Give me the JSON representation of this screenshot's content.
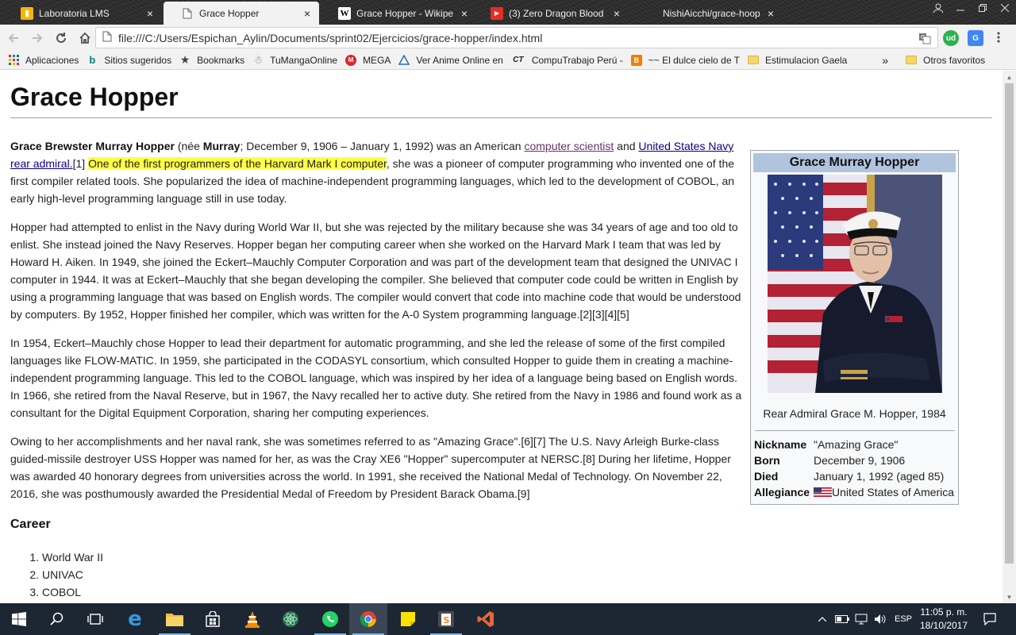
{
  "browser": {
    "tabs": [
      {
        "title": "Laboratoria LMS",
        "icon": "laboratoria-icon",
        "active": false
      },
      {
        "title": "Grace Hopper",
        "icon": "page-icon",
        "active": true
      },
      {
        "title": "Grace Hopper - Wikipe",
        "icon": "wikipedia-icon",
        "active": false
      },
      {
        "title": "(3) Zero Dragon Blood",
        "icon": "youtube-icon",
        "active": false
      },
      {
        "title": "NishiAicchi/grace-hoop",
        "icon": "github-icon",
        "active": false
      }
    ],
    "close_glyph": "×",
    "url": "file:///C:/Users/Espichan_Aylin/Documents/sprint02/Ejercicios/grace-hopper/index.html",
    "bookmarks": [
      {
        "label": "Aplicaciones",
        "icon": "apps-grid-icon"
      },
      {
        "label": "Sitios sugeridos",
        "icon": "bing-icon"
      },
      {
        "label": "Bookmarks",
        "icon": "star-icon"
      },
      {
        "label": "TuMangaOnline",
        "icon": "tumanga-icon"
      },
      {
        "label": "MEGA",
        "icon": "mega-icon"
      },
      {
        "label": "Ver Anime Online en",
        "icon": "anime-icon"
      },
      {
        "label": "CompuTrabajo Perú -",
        "icon": "computrabajo-icon"
      },
      {
        "label": "~~ El dulce cielo de T",
        "icon": "blogger-icon"
      },
      {
        "label": "Estimulacion Gaela",
        "icon": "folder-icon"
      }
    ],
    "overflow": "»",
    "other_bookmarks": "Otros favoritos",
    "colors": {
      "accent": "#4285f4",
      "tabstrip": "#2b2b2b",
      "toolbar": "#f2f2f2"
    }
  },
  "page": {
    "title": "Grace Hopper",
    "intro": {
      "name": "Grace Brewster Murray Hopper",
      "nee_open": " (née ",
      "maiden": "Murray",
      "dates": "; December 9, 1906 – January 1, 1992) was an American ",
      "link1": "computer scientist",
      "and": " and ",
      "link2": "United States Navy rear admiral.",
      "ref": "[1] ",
      "highlight": "One of the first programmers of the Harvard Mark I computer",
      "rest": ", she was a pioneer of computer programming who invented one of the first compiler related tools. She popularized the idea of machine-independent programming languages, which led to the development of COBOL, an early high-level programming language still in use today."
    },
    "paragraphs": [
      "Hopper had attempted to enlist in the Navy during World War II, but she was rejected by the military because she was 34 years of age and too old to enlist. She instead joined the Navy Reserves. Hopper began her computing career when she worked on the Harvard Mark I team that was led by Howard H. Aiken. In 1949, she joined the Eckert–Mauchly Computer Corporation and was part of the development team that designed the UNIVAC I computer in 1944. It was at Eckert–Mauchly that she began developing the compiler. She believed that computer code could be written in English by using a programming language that was based on English words. The compiler would convert that code into machine code that would be understood by computers. By 1952, Hopper finished her compiler, which was written for the A-0 System programming language.[2][3][4][5]",
      "In 1954, Eckert–Mauchly chose Hopper to lead their department for automatic programming, and she led the release of some of the first compiled languages like FLOW-MATIC. In 1959, she participated in the CODASYL consortium, which consulted Hopper to guide them in creating a machine-independent programming language. This led to the COBOL language, which was inspired by her idea of a language being based on English words. In 1966, she retired from the Naval Reserve, but in 1967, the Navy recalled her to active duty. She retired from the Navy in 1986 and found work as a consultant for the Digital Equipment Corporation, sharing her computing experiences.",
      "Owing to her accomplishments and her naval rank, she was sometimes referred to as \"Amazing Grace\".[6][7] The U.S. Navy Arleigh Burke-class guided-missile destroyer USS Hopper was named for her, as was the Cray XE6 \"Hopper\" supercomputer at NERSC.[8] During her lifetime, Hopper was awarded 40 honorary degrees from universities across the world. In 1991, she received the National Medal of Technology. On November 22, 2016, she was posthumously awarded the Presidential Medal of Freedom by President Barack Obama.[9]"
    ],
    "career_heading": "Career",
    "career_items": [
      "World War II",
      "UNIVAC",
      "COBOL"
    ],
    "highlight_color": "#ffff44"
  },
  "infobox": {
    "title": "Grace Murray Hopper",
    "caption": "Rear Admiral Grace M. Hopper, 1984",
    "rows": [
      {
        "key": "Nickname",
        "value": "\"Amazing Grace\""
      },
      {
        "key": "Born",
        "value": "December 9, 1906"
      },
      {
        "key": "Died",
        "value": "January 1, 1992 (aged 85)"
      },
      {
        "key": "Allegiance",
        "value": "United States of America",
        "icon": "us-flag-icon"
      }
    ],
    "header_color": "#b0c4de"
  },
  "taskbar": {
    "apps": [
      "start-icon",
      "search-icon",
      "task-view-icon",
      "edge-icon",
      "file-explorer-icon",
      "store-icon",
      "vlc-icon",
      "atom-icon",
      "whatsapp-icon",
      "chrome-icon",
      "sticky-notes-icon",
      "sublime-icon",
      "visual-studio-icon"
    ],
    "language": "ESP",
    "time": "11:05 p. m.",
    "date": "18/10/2017"
  }
}
